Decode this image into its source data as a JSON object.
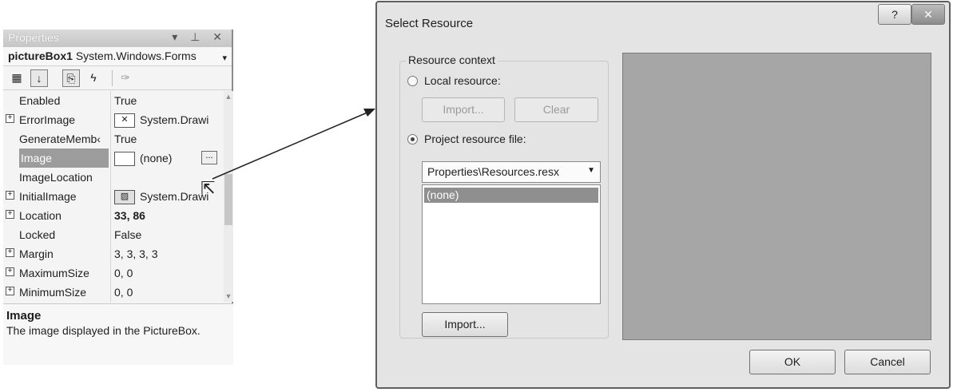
{
  "properties": {
    "title": "Properties",
    "title_icons": "▾ ⊥ ✕",
    "object_name": "pictureBox1",
    "object_type": "System.Windows.Forms",
    "rows": [
      {
        "name": "Enabled",
        "value": "True",
        "expander": false
      },
      {
        "name": "ErrorImage",
        "value": "System.Drawi",
        "expander": true,
        "swatch": "✕"
      },
      {
        "name": "GenerateMemb‹",
        "value": "True",
        "expander": false
      },
      {
        "name": "Image",
        "value": "(none)",
        "expander": false,
        "swatch": " "
      },
      {
        "name": "ImageLocation",
        "value": "",
        "expander": false
      },
      {
        "name": "InitialImage",
        "value": "System.Drawi",
        "expander": true,
        "swatch": "img"
      },
      {
        "name": "Location",
        "value": "33, 86",
        "expander": true
      },
      {
        "name": "Locked",
        "value": "False",
        "expander": false
      },
      {
        "name": "Margin",
        "value": "3, 3, 3, 3",
        "expander": true
      },
      {
        "name": "MaximumSize",
        "value": "0, 0",
        "expander": true
      },
      {
        "name": "MinimumSize",
        "value": "0, 0",
        "expander": true
      }
    ],
    "ellipsis_label": "...",
    "description_title": "Image",
    "description_text": "The image displayed in the PictureBox."
  },
  "dialog": {
    "title": "Select Resource",
    "help_label": "?",
    "close_label": "✕",
    "group_label": "Resource context",
    "local_resource_label": "Local resource:",
    "import_label_disabled": "Import...",
    "clear_label": "Clear",
    "project_resource_label": "Project resource file:",
    "resource_file": "Properties\\Resources.resx",
    "list_items": [
      "(none)"
    ],
    "import_label": "Import...",
    "ok_label": "OK",
    "cancel_label": "Cancel",
    "selected_option": "project"
  }
}
